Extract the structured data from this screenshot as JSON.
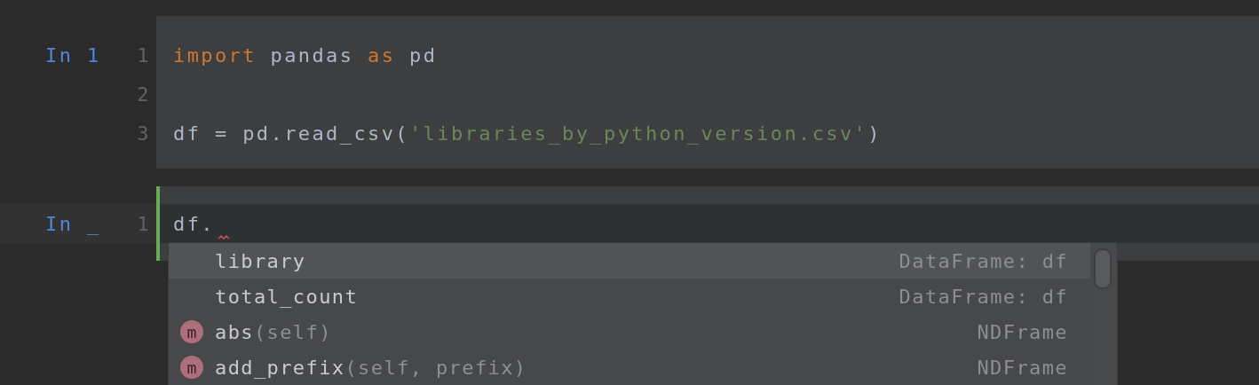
{
  "cells": [
    {
      "prompt": "In 1",
      "active": false,
      "lines": [
        {
          "number": "1",
          "tokens": [
            {
              "text": "import",
              "kind": "keyword"
            },
            {
              "text": " pandas ",
              "kind": "plain"
            },
            {
              "text": "as",
              "kind": "keyword"
            },
            {
              "text": " pd",
              "kind": "plain"
            }
          ]
        },
        {
          "number": "2"
        },
        {
          "number": "3",
          "tokens": [
            {
              "text": "df = pd.read_csv(",
              "kind": "plain"
            },
            {
              "text": "'libraries_by_python_version.csv'",
              "kind": "string"
            },
            {
              "text": ")",
              "kind": "plain"
            }
          ]
        }
      ]
    },
    {
      "prompt": "In _",
      "active": true,
      "lines": [
        {
          "number": "1",
          "current": true,
          "error_mark": true,
          "tokens": [
            {
              "text": "df.",
              "kind": "plain"
            }
          ]
        }
      ]
    }
  ],
  "completion": {
    "items": [
      {
        "kind": "field",
        "name": "library",
        "type": "DataFrame: df",
        "selected": true
      },
      {
        "kind": "field",
        "name": "total_count",
        "type": "DataFrame: df",
        "selected": false
      },
      {
        "kind": "method",
        "icon_letter": "m",
        "name": "abs",
        "params": "(self)",
        "type": "NDFrame",
        "selected": false
      },
      {
        "kind": "method",
        "icon_letter": "m",
        "name": "add_prefix",
        "params": "(self, prefix)",
        "type": "NDFrame",
        "selected": false
      }
    ]
  }
}
